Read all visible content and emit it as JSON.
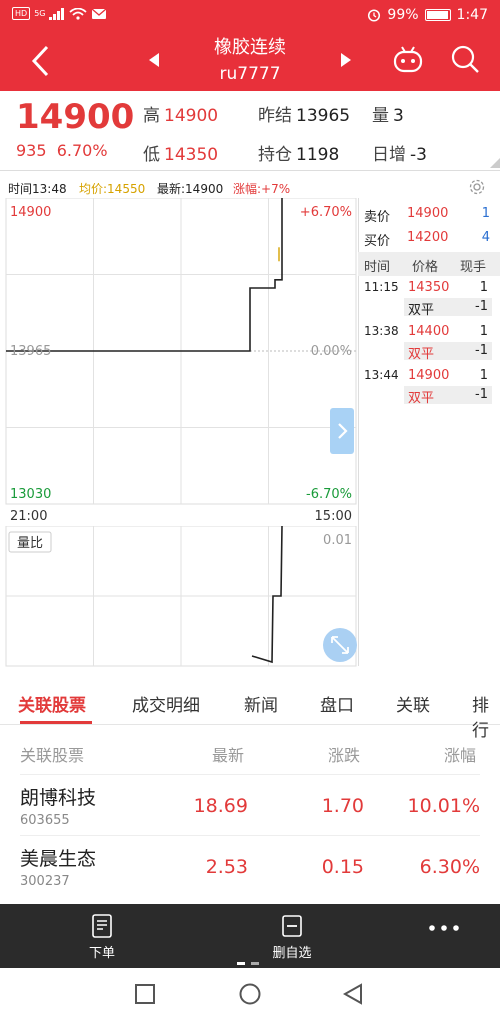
{
  "status": {
    "time": "1:47",
    "battery": "99%",
    "hd": "HD",
    "net": "5G"
  },
  "header": {
    "title": "橡胶连续",
    "subtitle": "ru7777"
  },
  "quote": {
    "price": "14900",
    "change": "935",
    "change_pct": "6.70%",
    "high_label": "高",
    "high": "14900",
    "low_label": "低",
    "low": "14350",
    "prev_settle_label": "昨结",
    "prev_settle": "13965",
    "open_interest_label": "持仓",
    "open_interest": "1198",
    "volume_label": "量",
    "volume": "3",
    "daily_inc_label": "日增",
    "daily_inc": "-3"
  },
  "chart_header": {
    "time": "时间13:48",
    "avg": "均价:14550",
    "latest": "最新:14900",
    "change": "涨幅:+7%"
  },
  "chart_data": [
    {
      "type": "line",
      "title": "",
      "series": [
        {
          "name": "",
          "x": [
            "21:00",
            "13:15",
            "13:15",
            "13:38",
            "13:38",
            "13:44",
            "13:44"
          ],
          "y": [
            13965,
            13965,
            14350,
            14350,
            14400,
            14400,
            14900
          ]
        }
      ],
      "ylim": [
        13030,
        14900
      ],
      "x_start_label": "21:00",
      "x_end_label": "15:00",
      "y_top_label": "14900",
      "y_mid_label": "13965",
      "y_bottom_label": "13030",
      "y_right_top": "+6.70%",
      "y_right_mid": "0.00%",
      "y_right_bottom": "-6.70%",
      "grid": true
    },
    {
      "type": "line",
      "label": "量比",
      "y_right_top": "0.01",
      "grid": true
    }
  ],
  "orderbook": {
    "sell_label": "卖价",
    "sell_price": "14900",
    "sell_qty": "1",
    "buy_label": "买价",
    "buy_price": "14200",
    "buy_qty": "4"
  },
  "ticks": {
    "headers": [
      "时间",
      "价格",
      "现手"
    ],
    "rows": [
      {
        "time": "11:15",
        "price": "14350",
        "qty": "1",
        "type": "双平",
        "delta": "-1"
      },
      {
        "time": "13:38",
        "price": "14400",
        "qty": "1",
        "type": "双平",
        "delta": "-1"
      },
      {
        "time": "13:44",
        "price": "14900",
        "qty": "1",
        "type": "双平",
        "delta": "-1"
      }
    ]
  },
  "tabs": [
    "关联股票",
    "成交明细",
    "新闻",
    "盘口",
    "关联",
    "排行"
  ],
  "table": {
    "headers": [
      "关联股票",
      "最新",
      "涨跌",
      "涨幅"
    ],
    "rows": [
      {
        "name": "朗博科技",
        "code": "603655",
        "latest": "18.69",
        "chg": "1.70",
        "pct": "10.01%"
      },
      {
        "name": "美晨生态",
        "code": "300237",
        "latest": "2.53",
        "chg": "0.15",
        "pct": "6.30%"
      }
    ]
  },
  "bottom": {
    "order": "下单",
    "remove_watch": "删自选"
  },
  "colors": {
    "brand_red": "#e8303a",
    "up_red": "#e23a3a",
    "down_green": "#1a9b3a",
    "avg_yellow": "#d6a200"
  }
}
